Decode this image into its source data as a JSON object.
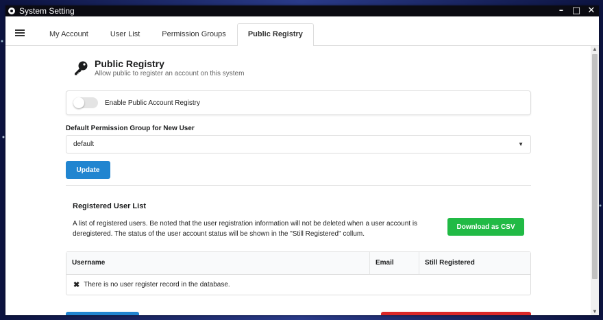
{
  "window": {
    "title": "System Setting",
    "controls": {
      "minimize": "–",
      "maximize": "□",
      "close": "✕"
    }
  },
  "tabs": [
    {
      "label": "My Account"
    },
    {
      "label": "User List"
    },
    {
      "label": "Permission Groups"
    },
    {
      "label": "Public Registry",
      "active": true
    }
  ],
  "header": {
    "icon": "key-icon",
    "title": "Public Registry",
    "subtitle": "Allow public to register an account on this system"
  },
  "registry_toggle": {
    "label": "Enable Public Account Registry",
    "enabled": false
  },
  "default_group": {
    "label": "Default Permission Group for New User",
    "value": "default"
  },
  "update_button": "Update",
  "registered_users": {
    "title": "Registered User List",
    "description": "A list of registered users. Be noted that the user registration information will not be deleted when a user account is deregistered. The status of the user account status will be shown in the \"Still Registered\" collum.",
    "download_button": "Download as CSV",
    "columns": [
      "Username",
      "Email",
      "Still Registered"
    ],
    "empty_message": "There is no user register record in the database."
  },
  "colors": {
    "primary": "#2185d0",
    "positive": "#21ba45",
    "negative": "#db2828",
    "titlebar": "#0b0b12"
  }
}
